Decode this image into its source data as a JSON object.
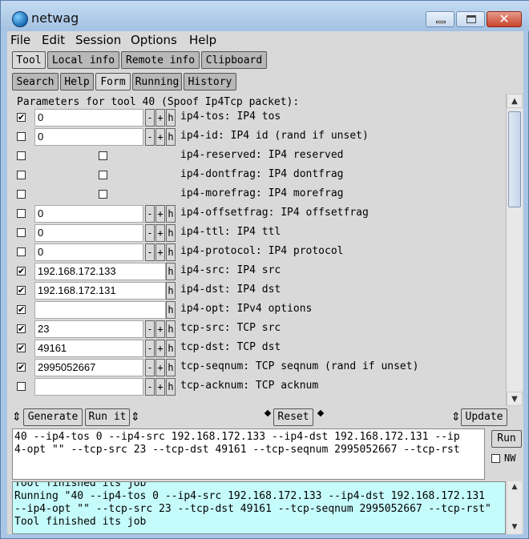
{
  "window": {
    "title": "netwag"
  },
  "menu": [
    "File",
    "Edit",
    "Session",
    "Options",
    "Help"
  ],
  "tabs_primary": [
    {
      "label": "Tool",
      "active": true
    },
    {
      "label": "Local info",
      "active": false
    },
    {
      "label": "Remote info",
      "active": false
    },
    {
      "label": "Clipboard",
      "active": false
    }
  ],
  "tabs_secondary": [
    {
      "label": "Search",
      "active": false
    },
    {
      "label": "Help",
      "active": false
    },
    {
      "label": "Form",
      "active": true
    },
    {
      "label": "Running",
      "active": false
    },
    {
      "label": "History",
      "active": false
    }
  ],
  "form": {
    "header": "Parameters for tool 40 (Spoof Ip4Tcp packet):",
    "rows": [
      {
        "checked": true,
        "value": "0",
        "label": "ip4-tos: IP4 tos",
        "kind": "num"
      },
      {
        "checked": false,
        "value": "0",
        "label": "ip4-id: IP4 id (rand if unset)",
        "kind": "num"
      },
      {
        "checked": false,
        "value": "",
        "label": "ip4-reserved: IP4 reserved",
        "kind": "bool"
      },
      {
        "checked": false,
        "value": "",
        "label": "ip4-dontfrag: IP4 dontfrag",
        "kind": "bool"
      },
      {
        "checked": false,
        "value": "",
        "label": "ip4-morefrag: IP4 morefrag",
        "kind": "bool"
      },
      {
        "checked": false,
        "value": "0",
        "label": "ip4-offsetfrag: IP4 offsetfrag",
        "kind": "num"
      },
      {
        "checked": false,
        "value": "0",
        "label": "ip4-ttl: IP4 ttl",
        "kind": "num"
      },
      {
        "checked": false,
        "value": "0",
        "label": "ip4-protocol: IP4 protocol",
        "kind": "num"
      },
      {
        "checked": true,
        "value": "192.168.172.133",
        "label": "ip4-src: IP4 src",
        "kind": "text"
      },
      {
        "checked": true,
        "value": "192.168.172.131",
        "label": "ip4-dst: IP4 dst",
        "kind": "text"
      },
      {
        "checked": true,
        "value": "",
        "label": "ip4-opt: IPv4 options",
        "kind": "text"
      },
      {
        "checked": true,
        "value": "23",
        "label": "tcp-src: TCP src",
        "kind": "num"
      },
      {
        "checked": true,
        "value": "49161",
        "label": "tcp-dst: TCP dst",
        "kind": "num"
      },
      {
        "checked": true,
        "value": "2995052667",
        "label": "tcp-seqnum: TCP seqnum (rand if unset)",
        "kind": "num"
      },
      {
        "checked": false,
        "value": "",
        "label": "tcp-acknum: TCP acknum",
        "kind": "num"
      }
    ],
    "spin_minus": "-",
    "spin_plus": "+",
    "spin_help": "h",
    "check_mark": "✔"
  },
  "actions": {
    "generate": "Generate",
    "run_it": "Run it",
    "reset": "Reset",
    "update": "Update"
  },
  "command": {
    "line1": "40 --ip4-tos 0 --ip4-src 192.168.172.133 --ip4-dst 192.168.172.131 --ip",
    "line2": "4-opt \"\" --tcp-src 23 --tcp-dst 49161 --tcp-seqnum 2995052667 --tcp-rst",
    "run": "Run",
    "nw": "NW"
  },
  "log": {
    "lines": [
      "Tool finished its job",
      "Running \"40 --ip4-tos 0 --ip4-src 192.168.172.133 --ip4-dst 192.168.172.131",
      "--ip4-opt \"\" --tcp-src 23 --tcp-dst 49161 --tcp-seqnum 2995052667 --tcp-rst\"",
      "Tool finished its job"
    ]
  }
}
